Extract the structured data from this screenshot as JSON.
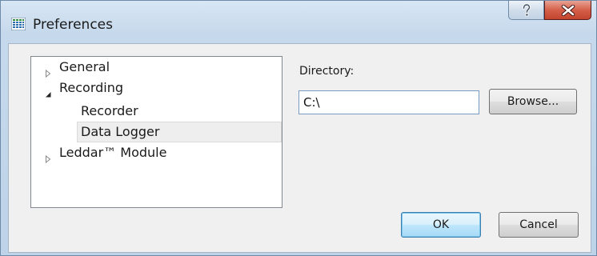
{
  "window": {
    "title": "Preferences",
    "icon": "grid-app-icon",
    "help_icon": "help-icon",
    "close_icon": "close-icon"
  },
  "tree": {
    "items": [
      {
        "label": "General",
        "level": 0,
        "state": "collapsed"
      },
      {
        "label": "Recording",
        "level": 0,
        "state": "expanded"
      },
      {
        "label": "Recorder",
        "level": 1,
        "state": "leaf"
      },
      {
        "label": "Data Logger",
        "level": 1,
        "state": "leaf",
        "selected": true
      },
      {
        "label": "Leddar™ Module",
        "level": 0,
        "state": "collapsed"
      }
    ]
  },
  "settings": {
    "directory_label": "Directory:",
    "directory_value": "C:\\",
    "browse_label": "Browse..."
  },
  "buttons": {
    "ok_label": "OK",
    "cancel_label": "Cancel"
  },
  "colors": {
    "title_bar": "#c6d9ec",
    "close_button": "#c2442d",
    "selection": "#eeeeee",
    "default_button_border": "#3c7fb1"
  }
}
